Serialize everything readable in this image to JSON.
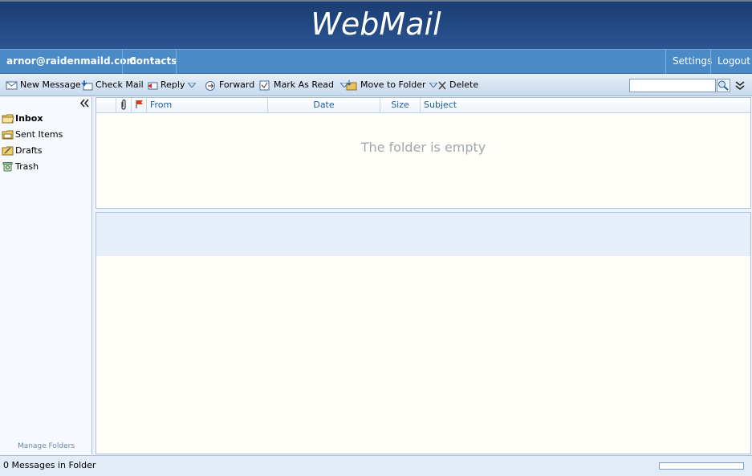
{
  "app": {
    "logo": "WebMail"
  },
  "topnav": {
    "account": "arnor@raidenmaild.com",
    "contacts": "Contacts",
    "settings": "Settings",
    "logout": "Logout"
  },
  "toolbar": {
    "new_message": "New Message",
    "check_mail": "Check Mail",
    "reply": "Reply",
    "forward": "Forward",
    "mark_as_read": "Mark As Read",
    "move_to_folder": "Move to Folder",
    "delete": "Delete",
    "search_value": ""
  },
  "folders": [
    {
      "name": "Inbox",
      "icon": "inbox-folder-icon",
      "active": true
    },
    {
      "name": "Sent Items",
      "icon": "sent-folder-icon",
      "active": false
    },
    {
      "name": "Drafts",
      "icon": "drafts-folder-icon",
      "active": false
    },
    {
      "name": "Trash",
      "icon": "trash-icon",
      "active": false
    }
  ],
  "sidebar": {
    "manage_folders": "Manage Folders"
  },
  "message_list": {
    "columns": {
      "from": "From",
      "date": "Date",
      "size": "Size",
      "subject": "Subject"
    },
    "empty_text": "The folder is empty"
  },
  "status": {
    "text": "0 Messages in Folder",
    "progress": 0
  },
  "colors": {
    "header": "#234a84",
    "nav": "#4a8ac6",
    "link": "#1f5c9c"
  }
}
